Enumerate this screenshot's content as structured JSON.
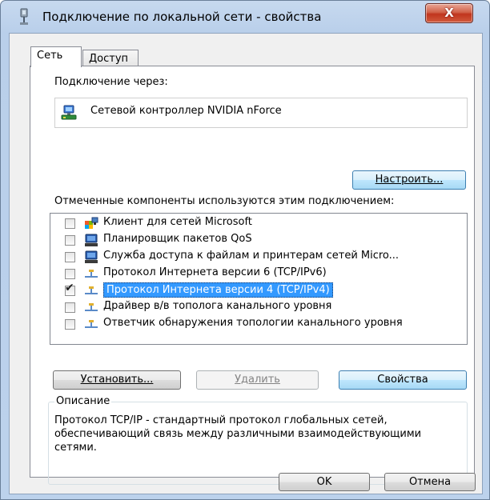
{
  "window": {
    "title": "Подключение по локальной сети - свойства",
    "close_label": "X"
  },
  "tabs": [
    {
      "label": "Сеть",
      "active": true
    },
    {
      "label": "Доступ",
      "active": false
    }
  ],
  "connect_via": {
    "label": "Подключение через:",
    "adapter_name": "Сетевой контроллер NVIDIA nForce"
  },
  "configure_button": {
    "label": "Настроить..."
  },
  "components": {
    "label": "Отмеченные компоненты используются этим подключением:",
    "items": [
      {
        "label": "Клиент для сетей Microsoft",
        "checked": false,
        "selected": false,
        "icon": "network-client-icon"
      },
      {
        "label": "Планировщик пакетов QoS",
        "checked": false,
        "selected": false,
        "icon": "computer-service-icon"
      },
      {
        "label": "Служба доступа к файлам и принтерам сетей Micro...",
        "checked": false,
        "selected": false,
        "icon": "computer-service-icon"
      },
      {
        "label": "Протокол Интернета версии 6 (TCP/IPv6)",
        "checked": false,
        "selected": false,
        "icon": "protocol-icon"
      },
      {
        "label": "Протокол Интернета версии 4 (TCP/IPv4)",
        "checked": true,
        "selected": true,
        "icon": "protocol-icon"
      },
      {
        "label": "Драйвер в/в тополога канального уровня",
        "checked": false,
        "selected": false,
        "icon": "protocol-icon"
      },
      {
        "label": "Ответчик обнаружения топологии канального уровня",
        "checked": false,
        "selected": false,
        "icon": "protocol-icon"
      }
    ]
  },
  "actions": {
    "install": "Установить...",
    "remove": "Удалить",
    "properties": "Свойства"
  },
  "description": {
    "legend": "Описание",
    "text": "Протокол TCP/IP - стандартный протокол глобальных сетей, обеспечивающий связь между различными взаимодействующими сетями."
  },
  "dialog_buttons": {
    "ok": "OK",
    "cancel": "Отмена"
  },
  "colors": {
    "selection": "#3399ff",
    "close_button": "#c7402a"
  }
}
